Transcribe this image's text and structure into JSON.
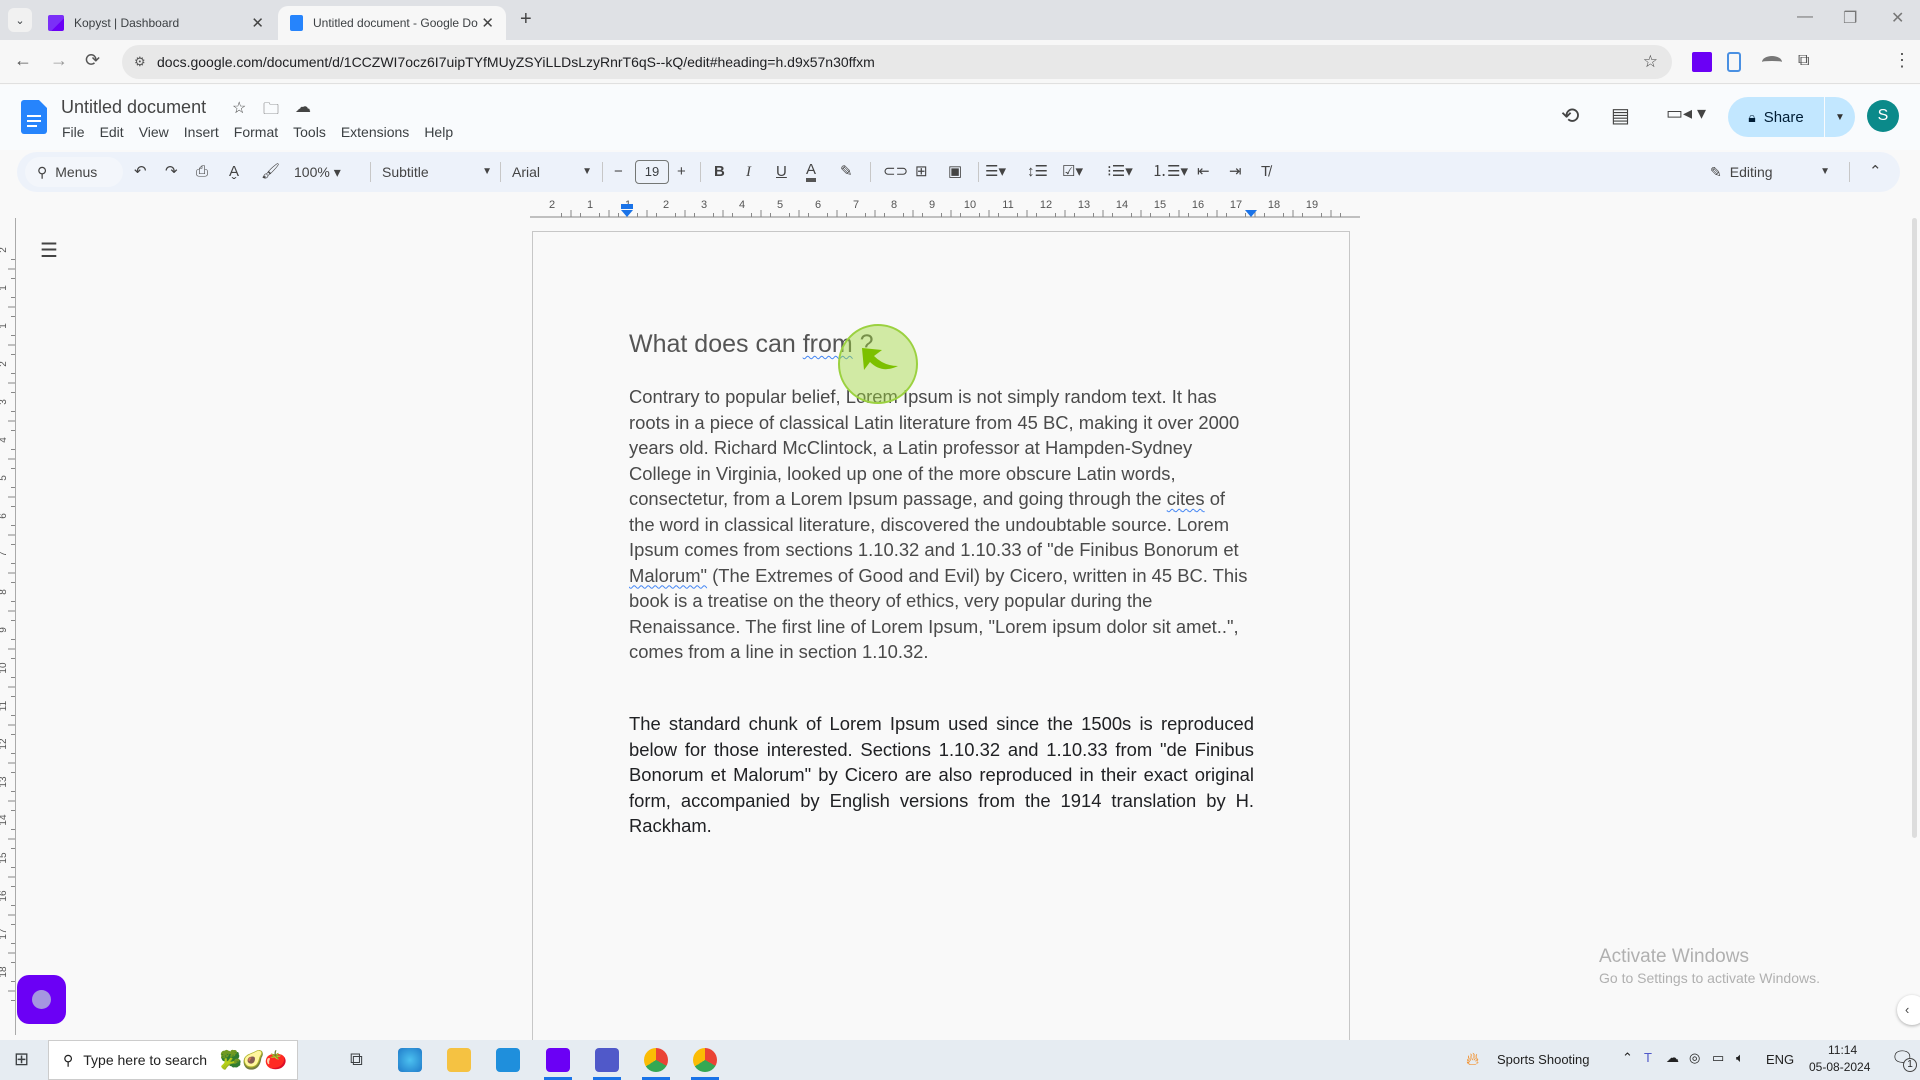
{
  "browser": {
    "tabs": [
      {
        "title": "Kopyst | Dashboard",
        "active": false
      },
      {
        "title": "Untitled document - Google Do",
        "active": true
      }
    ],
    "url": "docs.google.com/document/d/1CCZWI7ocz6I7uipTYfMUyZSYiLLDsLzyRnrT6qS--kQ/edit#heading=h.d9x57n30ffxm",
    "profile_initial": "S",
    "icons": {
      "back": "←",
      "forward": "→",
      "reload": "⟳",
      "site_info": "⚙",
      "bookmark": "☆",
      "tab_menu": "⌄",
      "new_tab": "+",
      "minimize": "—",
      "restore": "❐",
      "close": "✕",
      "more": "⋮"
    }
  },
  "docs": {
    "title": "Untitled document",
    "menu": [
      "File",
      "Edit",
      "View",
      "Insert",
      "Format",
      "Tools",
      "Extensions",
      "Help"
    ],
    "share_label": "Share",
    "avatar_initial": "S",
    "toolbar": {
      "search_label": "Menus",
      "zoom": "100%",
      "style": "Subtitle",
      "font": "Arial",
      "font_size": "19",
      "mode": "Editing"
    },
    "ruler_labels": [
      "2",
      "1",
      "1",
      "2",
      "3",
      "4",
      "5",
      "6",
      "7",
      "8",
      "9",
      "10",
      "11",
      "12",
      "13",
      "14",
      "15",
      "16",
      "17",
      "18",
      "19"
    ],
    "vruler_labels": [
      "2",
      "1",
      "1",
      "2",
      "3",
      "4",
      "5",
      "6",
      "7",
      "8",
      "9",
      "10",
      "11",
      "12",
      "13",
      "14",
      "15",
      "16",
      "17",
      "18"
    ]
  },
  "document": {
    "heading_before": "What does can ",
    "heading_misspelled": "from",
    "heading_after": " ?",
    "para1_parts": [
      " Contrary to popular belief, Lorem Ipsum is not simply random text. It has roots in a piece of classical Latin literature from 45 BC, making it over 2000 years old. Richard McClintock, a Latin professor at Hampden-Sydney College in Virginia, looked up one of the more obscure Latin words, consectetur, from a Lorem Ipsum passage, and going through the ",
      "cites",
      " of the word in classical literature, discovered the undoubtable source. Lorem Ipsum comes from sections 1.10.32 and 1.10.33 of \"de Finibus Bonorum et ",
      "Malorum\"",
      " (The Extremes of Good and Evil) by Cicero, written in 45 BC. This book is a treatise on the theory of ethics, very popular during the Renaissance. The first line of Lorem Ipsum, \"Lorem ipsum dolor sit amet..\", comes from a line in section 1.10.32."
    ],
    "para2": "The standard chunk of Lorem Ipsum used since the 1500s is reproduced below for those interested. Sections 1.10.32 and 1.10.33 from \"de Finibus Bonorum et Malorum\" by Cicero are also reproduced in their exact original form, accompanied by English versions from the 1914 translation by H. Rackham."
  },
  "watermark": {
    "title": "Activate Windows",
    "subtitle": "Go to Settings to activate Windows."
  },
  "taskbar": {
    "search_placeholder": "Type here to search",
    "weather": "Sports Shooting",
    "language": "ENG",
    "time": "11:14",
    "date": "05-08-2024",
    "notification_count": "1"
  },
  "colors": {
    "docs_blue": "#2684fc",
    "share_bg": "#c2e7ff",
    "toolbar_bg": "#edf2fa",
    "avatar": "#0b8a8a",
    "kopyst": "#6b00f5",
    "click_highlight": "#9bd140"
  }
}
